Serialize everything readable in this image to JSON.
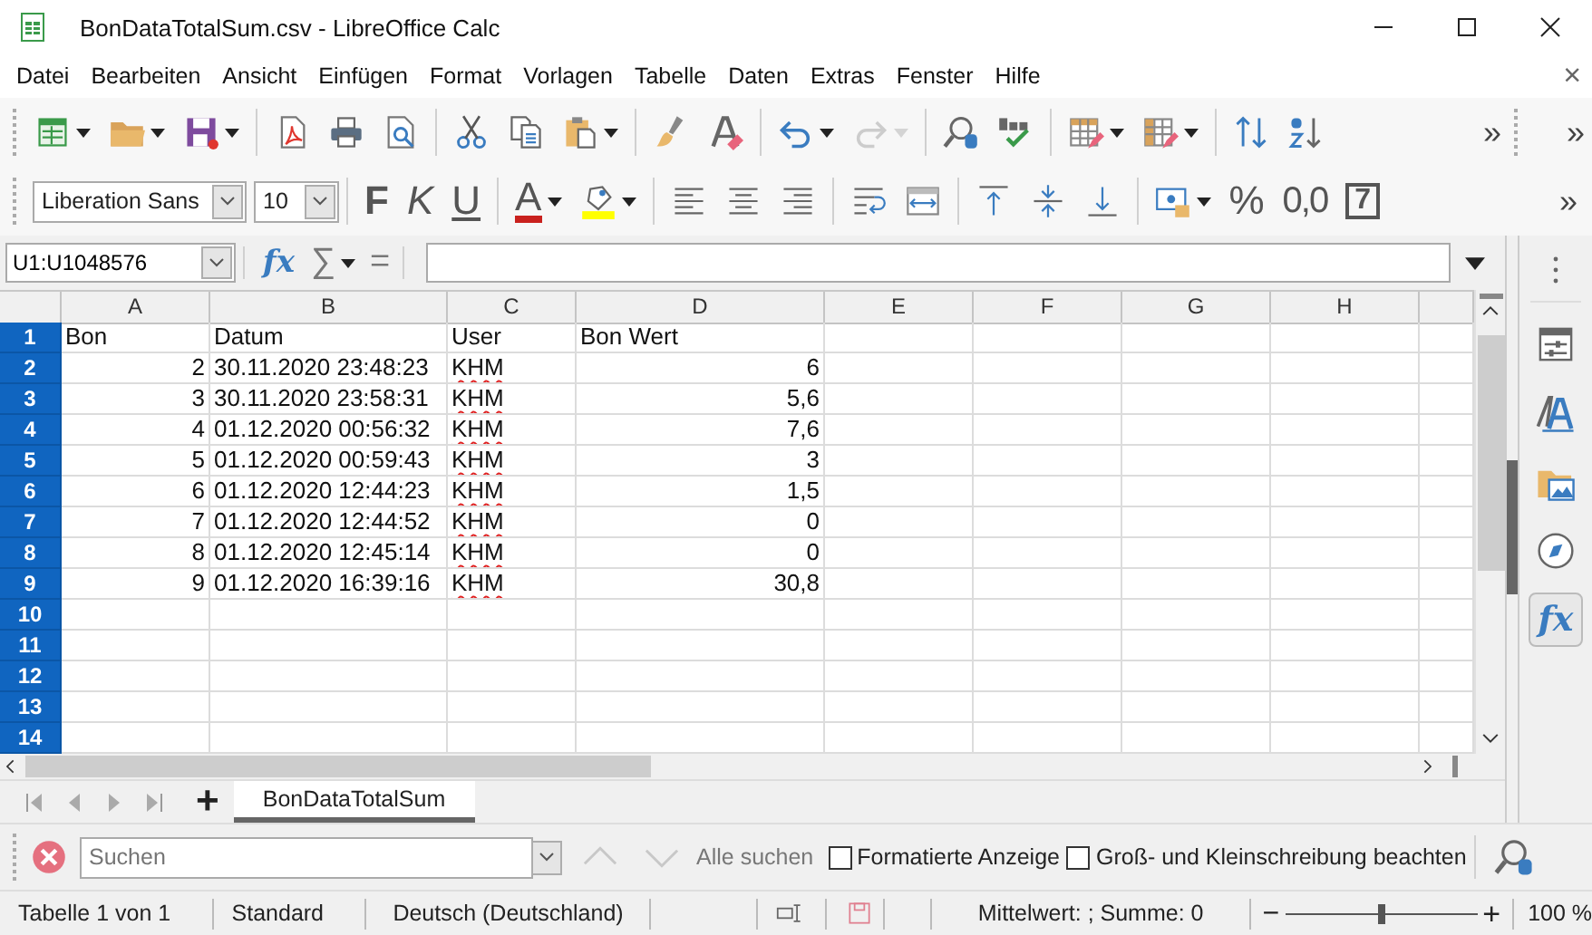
{
  "window": {
    "title": "BonDataTotalSum.csv - LibreOffice Calc"
  },
  "menu": [
    "Datei",
    "Bearbeiten",
    "Ansicht",
    "Einfügen",
    "Format",
    "Vorlagen",
    "Tabelle",
    "Daten",
    "Extras",
    "Fenster",
    "Hilfe"
  ],
  "menu_close": "×",
  "toolbar_standard": {
    "groups": [
      [
        {
          "kind": "new-sheet",
          "dropdown": true,
          "disabled": false
        },
        {
          "kind": "open",
          "dropdown": true,
          "disabled": false
        },
        {
          "kind": "save",
          "dropdown": true,
          "disabled": false
        }
      ],
      [
        {
          "kind": "pdf",
          "dropdown": false,
          "disabled": false
        },
        {
          "kind": "print",
          "dropdown": false,
          "disabled": false
        },
        {
          "kind": "preview",
          "dropdown": false,
          "disabled": false
        }
      ],
      [
        {
          "kind": "cut",
          "dropdown": false,
          "disabled": false
        },
        {
          "kind": "copy",
          "dropdown": false,
          "disabled": false
        },
        {
          "kind": "paste",
          "dropdown": true,
          "disabled": false
        }
      ],
      [
        {
          "kind": "brush",
          "dropdown": false,
          "disabled": false
        },
        {
          "kind": "clear-format",
          "dropdown": false,
          "disabled": false
        }
      ],
      [
        {
          "kind": "undo",
          "dropdown": true,
          "disabled": false
        },
        {
          "kind": "redo",
          "dropdown": true,
          "disabled": true
        }
      ],
      [
        {
          "kind": "find",
          "dropdown": false,
          "disabled": false
        },
        {
          "kind": "spelling",
          "dropdown": false,
          "disabled": false
        }
      ],
      [
        {
          "kind": "row",
          "dropdown": true,
          "disabled": false
        },
        {
          "kind": "column",
          "dropdown": true,
          "disabled": false
        }
      ],
      [
        {
          "kind": "sort",
          "dropdown": false,
          "disabled": false
        },
        {
          "kind": "sort-az",
          "dropdown": false,
          "disabled": false
        }
      ]
    ],
    "overflow": "»"
  },
  "toolbar_extra": {
    "overflow": "»"
  },
  "toolbar_formatting": {
    "font_name": "Liberation Sans",
    "font_size": "10",
    "groups": [
      [
        {
          "kind": "bold",
          "label": "F",
          "dropdown": false,
          "disabled": false
        },
        {
          "kind": "italic",
          "label": "K",
          "dropdown": false,
          "disabled": false
        },
        {
          "kind": "underline",
          "label": "U",
          "dropdown": false,
          "disabled": false
        }
      ],
      [
        {
          "kind": "font-color",
          "label": "A",
          "dropdown": true,
          "disabled": false
        },
        {
          "kind": "highlight",
          "dropdown": true,
          "disabled": false
        }
      ],
      [
        {
          "kind": "align-left",
          "dropdown": false,
          "disabled": false
        },
        {
          "kind": "align-center",
          "dropdown": false,
          "disabled": false
        },
        {
          "kind": "align-right",
          "dropdown": false,
          "disabled": false
        }
      ],
      [
        {
          "kind": "wrap",
          "dropdown": false,
          "disabled": false
        },
        {
          "kind": "merge",
          "dropdown": false,
          "disabled": false
        }
      ],
      [
        {
          "kind": "align-top",
          "dropdown": false,
          "disabled": false
        },
        {
          "kind": "align-middle",
          "dropdown": false,
          "disabled": false
        },
        {
          "kind": "align-bottom",
          "dropdown": false,
          "disabled": false
        }
      ],
      [
        {
          "kind": "number-format",
          "dropdown": true,
          "disabled": false
        },
        {
          "kind": "percent",
          "label": "%",
          "dropdown": false,
          "disabled": false
        },
        {
          "kind": "decimal",
          "label": "0,0",
          "dropdown": false,
          "disabled": false
        },
        {
          "kind": "box",
          "label": "7",
          "dropdown": false,
          "disabled": false
        }
      ]
    ],
    "overflow": "»"
  },
  "formula_bar": {
    "name_box": "U1:U1048576",
    "wizard": "fx",
    "sum": "∑",
    "equals": "="
  },
  "sheet": {
    "columns": [
      "A",
      "B",
      "C",
      "D",
      "E",
      "F",
      "G",
      "H"
    ],
    "rows": [
      {
        "header": "1",
        "selected": true,
        "cells": [
          {
            "text": "Bon",
            "kind": "text",
            "misspelled": false
          },
          {
            "text": "Datum",
            "kind": "text",
            "misspelled": false
          },
          {
            "text": "User",
            "kind": "text",
            "misspelled": false
          },
          {
            "text": "Bon Wert",
            "kind": "text",
            "misspelled": false
          }
        ]
      },
      {
        "header": "2",
        "selected": true,
        "cells": [
          {
            "text": "2",
            "kind": "number",
            "misspelled": false
          },
          {
            "text": "30.11.2020 23:48:23",
            "kind": "text",
            "misspelled": false
          },
          {
            "text": "KHM",
            "kind": "text",
            "misspelled": true
          },
          {
            "text": "6",
            "kind": "number",
            "misspelled": false
          }
        ]
      },
      {
        "header": "3",
        "selected": true,
        "cells": [
          {
            "text": "3",
            "kind": "number",
            "misspelled": false
          },
          {
            "text": "30.11.2020 23:58:31",
            "kind": "text",
            "misspelled": false
          },
          {
            "text": "KHM",
            "kind": "text",
            "misspelled": true
          },
          {
            "text": "5,6",
            "kind": "number",
            "misspelled": false
          }
        ]
      },
      {
        "header": "4",
        "selected": true,
        "cells": [
          {
            "text": "4",
            "kind": "number",
            "misspelled": false
          },
          {
            "text": "01.12.2020 00:56:32",
            "kind": "text",
            "misspelled": false
          },
          {
            "text": "KHM",
            "kind": "text",
            "misspelled": true
          },
          {
            "text": "7,6",
            "kind": "number",
            "misspelled": false
          }
        ]
      },
      {
        "header": "5",
        "selected": true,
        "cells": [
          {
            "text": "5",
            "kind": "number",
            "misspelled": false
          },
          {
            "text": "01.12.2020 00:59:43",
            "kind": "text",
            "misspelled": false
          },
          {
            "text": "KHM",
            "kind": "text",
            "misspelled": true
          },
          {
            "text": "3",
            "kind": "number",
            "misspelled": false
          }
        ]
      },
      {
        "header": "6",
        "selected": true,
        "cells": [
          {
            "text": "6",
            "kind": "number",
            "misspelled": false
          },
          {
            "text": "01.12.2020 12:44:23",
            "kind": "text",
            "misspelled": false
          },
          {
            "text": "KHM",
            "kind": "text",
            "misspelled": true
          },
          {
            "text": "1,5",
            "kind": "number",
            "misspelled": false
          }
        ]
      },
      {
        "header": "7",
        "selected": true,
        "cells": [
          {
            "text": "7",
            "kind": "number",
            "misspelled": false
          },
          {
            "text": "01.12.2020 12:44:52",
            "kind": "text",
            "misspelled": false
          },
          {
            "text": "KHM",
            "kind": "text",
            "misspelled": true
          },
          {
            "text": "0",
            "kind": "number",
            "misspelled": false
          }
        ]
      },
      {
        "header": "8",
        "selected": true,
        "cells": [
          {
            "text": "8",
            "kind": "number",
            "misspelled": false
          },
          {
            "text": "01.12.2020 12:45:14",
            "kind": "text",
            "misspelled": false
          },
          {
            "text": "KHM",
            "kind": "text",
            "misspelled": true
          },
          {
            "text": "0",
            "kind": "number",
            "misspelled": false
          }
        ]
      },
      {
        "header": "9",
        "selected": true,
        "cells": [
          {
            "text": "9",
            "kind": "number",
            "misspelled": false
          },
          {
            "text": "01.12.2020 16:39:16",
            "kind": "text",
            "misspelled": false
          },
          {
            "text": "KHM",
            "kind": "text",
            "misspelled": true
          },
          {
            "text": "30,8",
            "kind": "number",
            "misspelled": false
          }
        ]
      },
      {
        "header": "10",
        "selected": true
      },
      {
        "header": "11",
        "selected": true
      },
      {
        "header": "12",
        "selected": true
      },
      {
        "header": "13",
        "selected": true
      },
      {
        "header": "14",
        "selected": true
      }
    ]
  },
  "sheet_tabs": {
    "add": "+",
    "tabs": [
      {
        "label": "BonDataTotalSum",
        "selected": true
      }
    ]
  },
  "find_bar": {
    "placeholder": "Suchen",
    "find_all": "Alle suchen",
    "options": [
      {
        "label": "Formatierte Anzeige",
        "checked": false
      },
      {
        "label": "Groß- und Kleinschreibung beachten",
        "checked": false
      }
    ]
  },
  "status_bar": {
    "sheet": "Tabelle 1 von 1",
    "page_style": "Standard",
    "language": "Deutsch (Deutschland)",
    "summary": "Mittelwert: ; Summe: 0",
    "zoom": {
      "minus": "−",
      "plus": "+",
      "level": 0.5,
      "reading": "100 %"
    }
  },
  "sidebar": {
    "items": [
      {
        "kind": "properties",
        "selected": false
      },
      {
        "kind": "styles",
        "selected": false
      },
      {
        "kind": "gallery",
        "selected": false
      },
      {
        "kind": "navigator",
        "selected": false
      },
      {
        "kind": "functions",
        "label": "fx",
        "selected": true
      }
    ]
  }
}
